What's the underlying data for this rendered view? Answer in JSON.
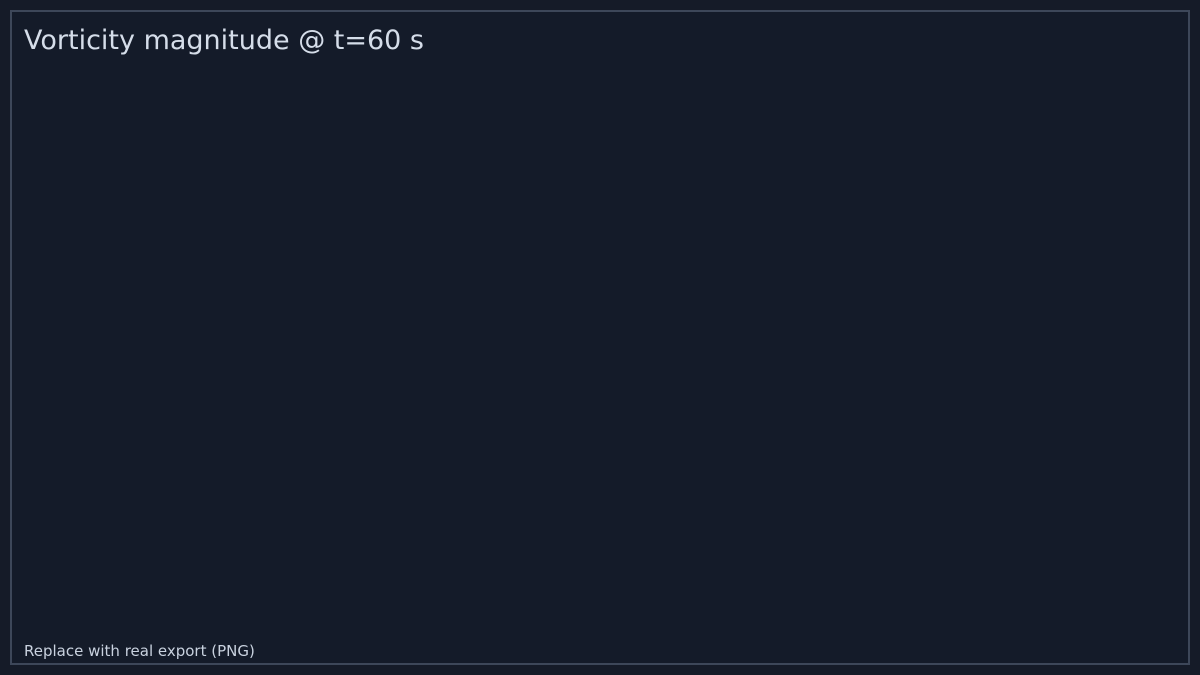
{
  "title": "Vorticity magnitude @ t=60 s",
  "caption": "Replace with real export (PNG)",
  "colors": {
    "background": "#141b29",
    "border": "#3d4759",
    "text": "#d5dde9"
  }
}
